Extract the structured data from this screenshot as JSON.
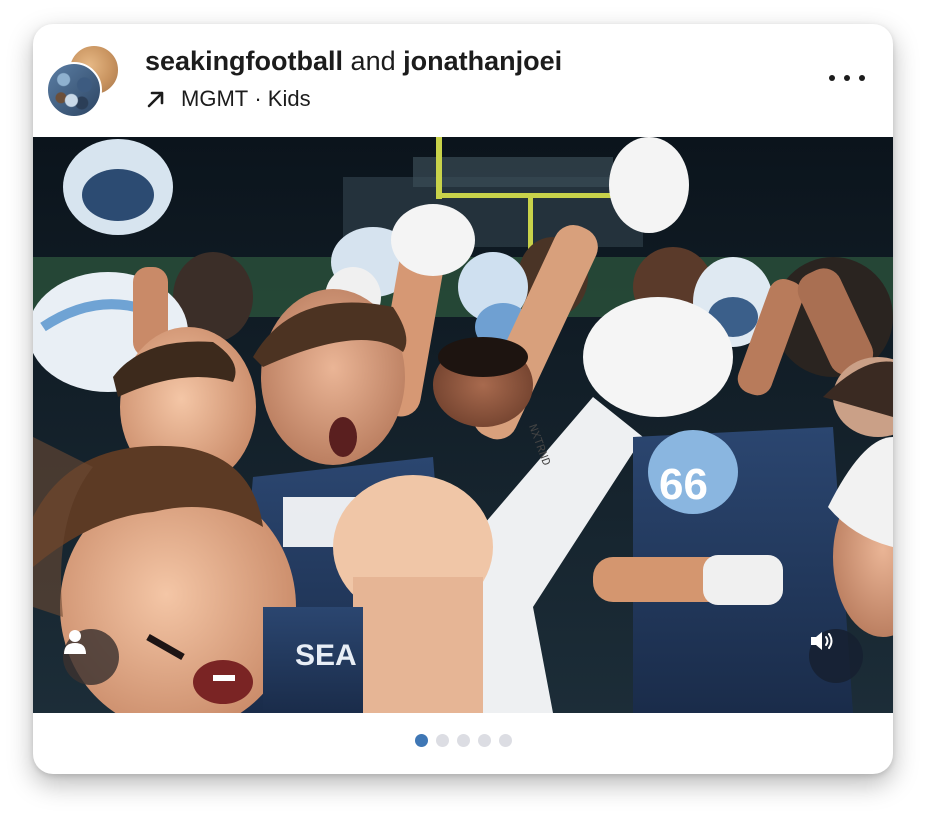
{
  "post": {
    "author_primary": "seakingfootball",
    "connector": "and",
    "author_secondary": "jonathanjoei",
    "audio_artist": "MGMT",
    "audio_separator": "·",
    "audio_track": "Kids",
    "more_icon": "more-horizontal-icon",
    "audio_icon": "arrow-up-right-icon"
  },
  "media": {
    "jersey_number": "66",
    "jersey_text": "SEA",
    "sleeve_text": "NXTRND",
    "profile_icon": "person-icon",
    "sound_icon": "speaker-icon"
  },
  "carousel": {
    "count": 5,
    "active_index": 0,
    "active_color": "#3f77b5",
    "inactive_color": "#dcdde3"
  }
}
